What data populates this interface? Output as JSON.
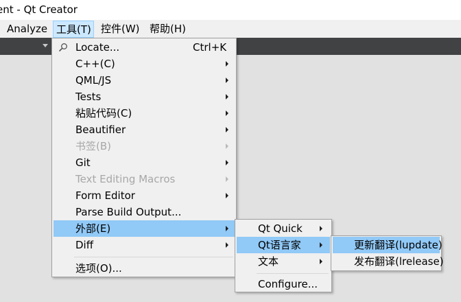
{
  "window": {
    "title": "ent - Qt Creator"
  },
  "menubar": {
    "items": [
      {
        "label": "Analyze"
      },
      {
        "label": "工具(T)"
      },
      {
        "label": "控件(W)"
      },
      {
        "label": "帮助(H)"
      }
    ]
  },
  "tools_menu": {
    "items": [
      {
        "label": "Locate...",
        "shortcut": "Ctrl+K",
        "icon": "search-icon"
      },
      {
        "label": "C++(C)"
      },
      {
        "label": "QML/JS"
      },
      {
        "label": "Tests"
      },
      {
        "label": "粘贴代码(C)"
      },
      {
        "label": "Beautifier"
      },
      {
        "label": "书签(B)",
        "disabled": true
      },
      {
        "label": "Git"
      },
      {
        "label": "Text Editing Macros",
        "disabled": true
      },
      {
        "label": "Form Editor"
      },
      {
        "label": "Parse Build Output..."
      },
      {
        "label": "外部(E)",
        "highlighted": true
      },
      {
        "label": "Diff"
      },
      {
        "label": "选项(O)..."
      }
    ]
  },
  "external_menu": {
    "items": [
      {
        "label": "Qt Quick"
      },
      {
        "label": "Qt语言家",
        "highlighted": true
      },
      {
        "label": "文本"
      },
      {
        "label": "Configure..."
      }
    ]
  },
  "linguist_menu": {
    "items": [
      {
        "label": "更新翻译(lupdate)",
        "highlighted": true
      },
      {
        "label": "发布翻译(lrelease)"
      }
    ]
  },
  "colors": {
    "highlight": "#91c9f7",
    "menu_bg": "#f0f0f0",
    "toolbar_bg": "#404244",
    "disabled_text": "#a7a7a7"
  }
}
